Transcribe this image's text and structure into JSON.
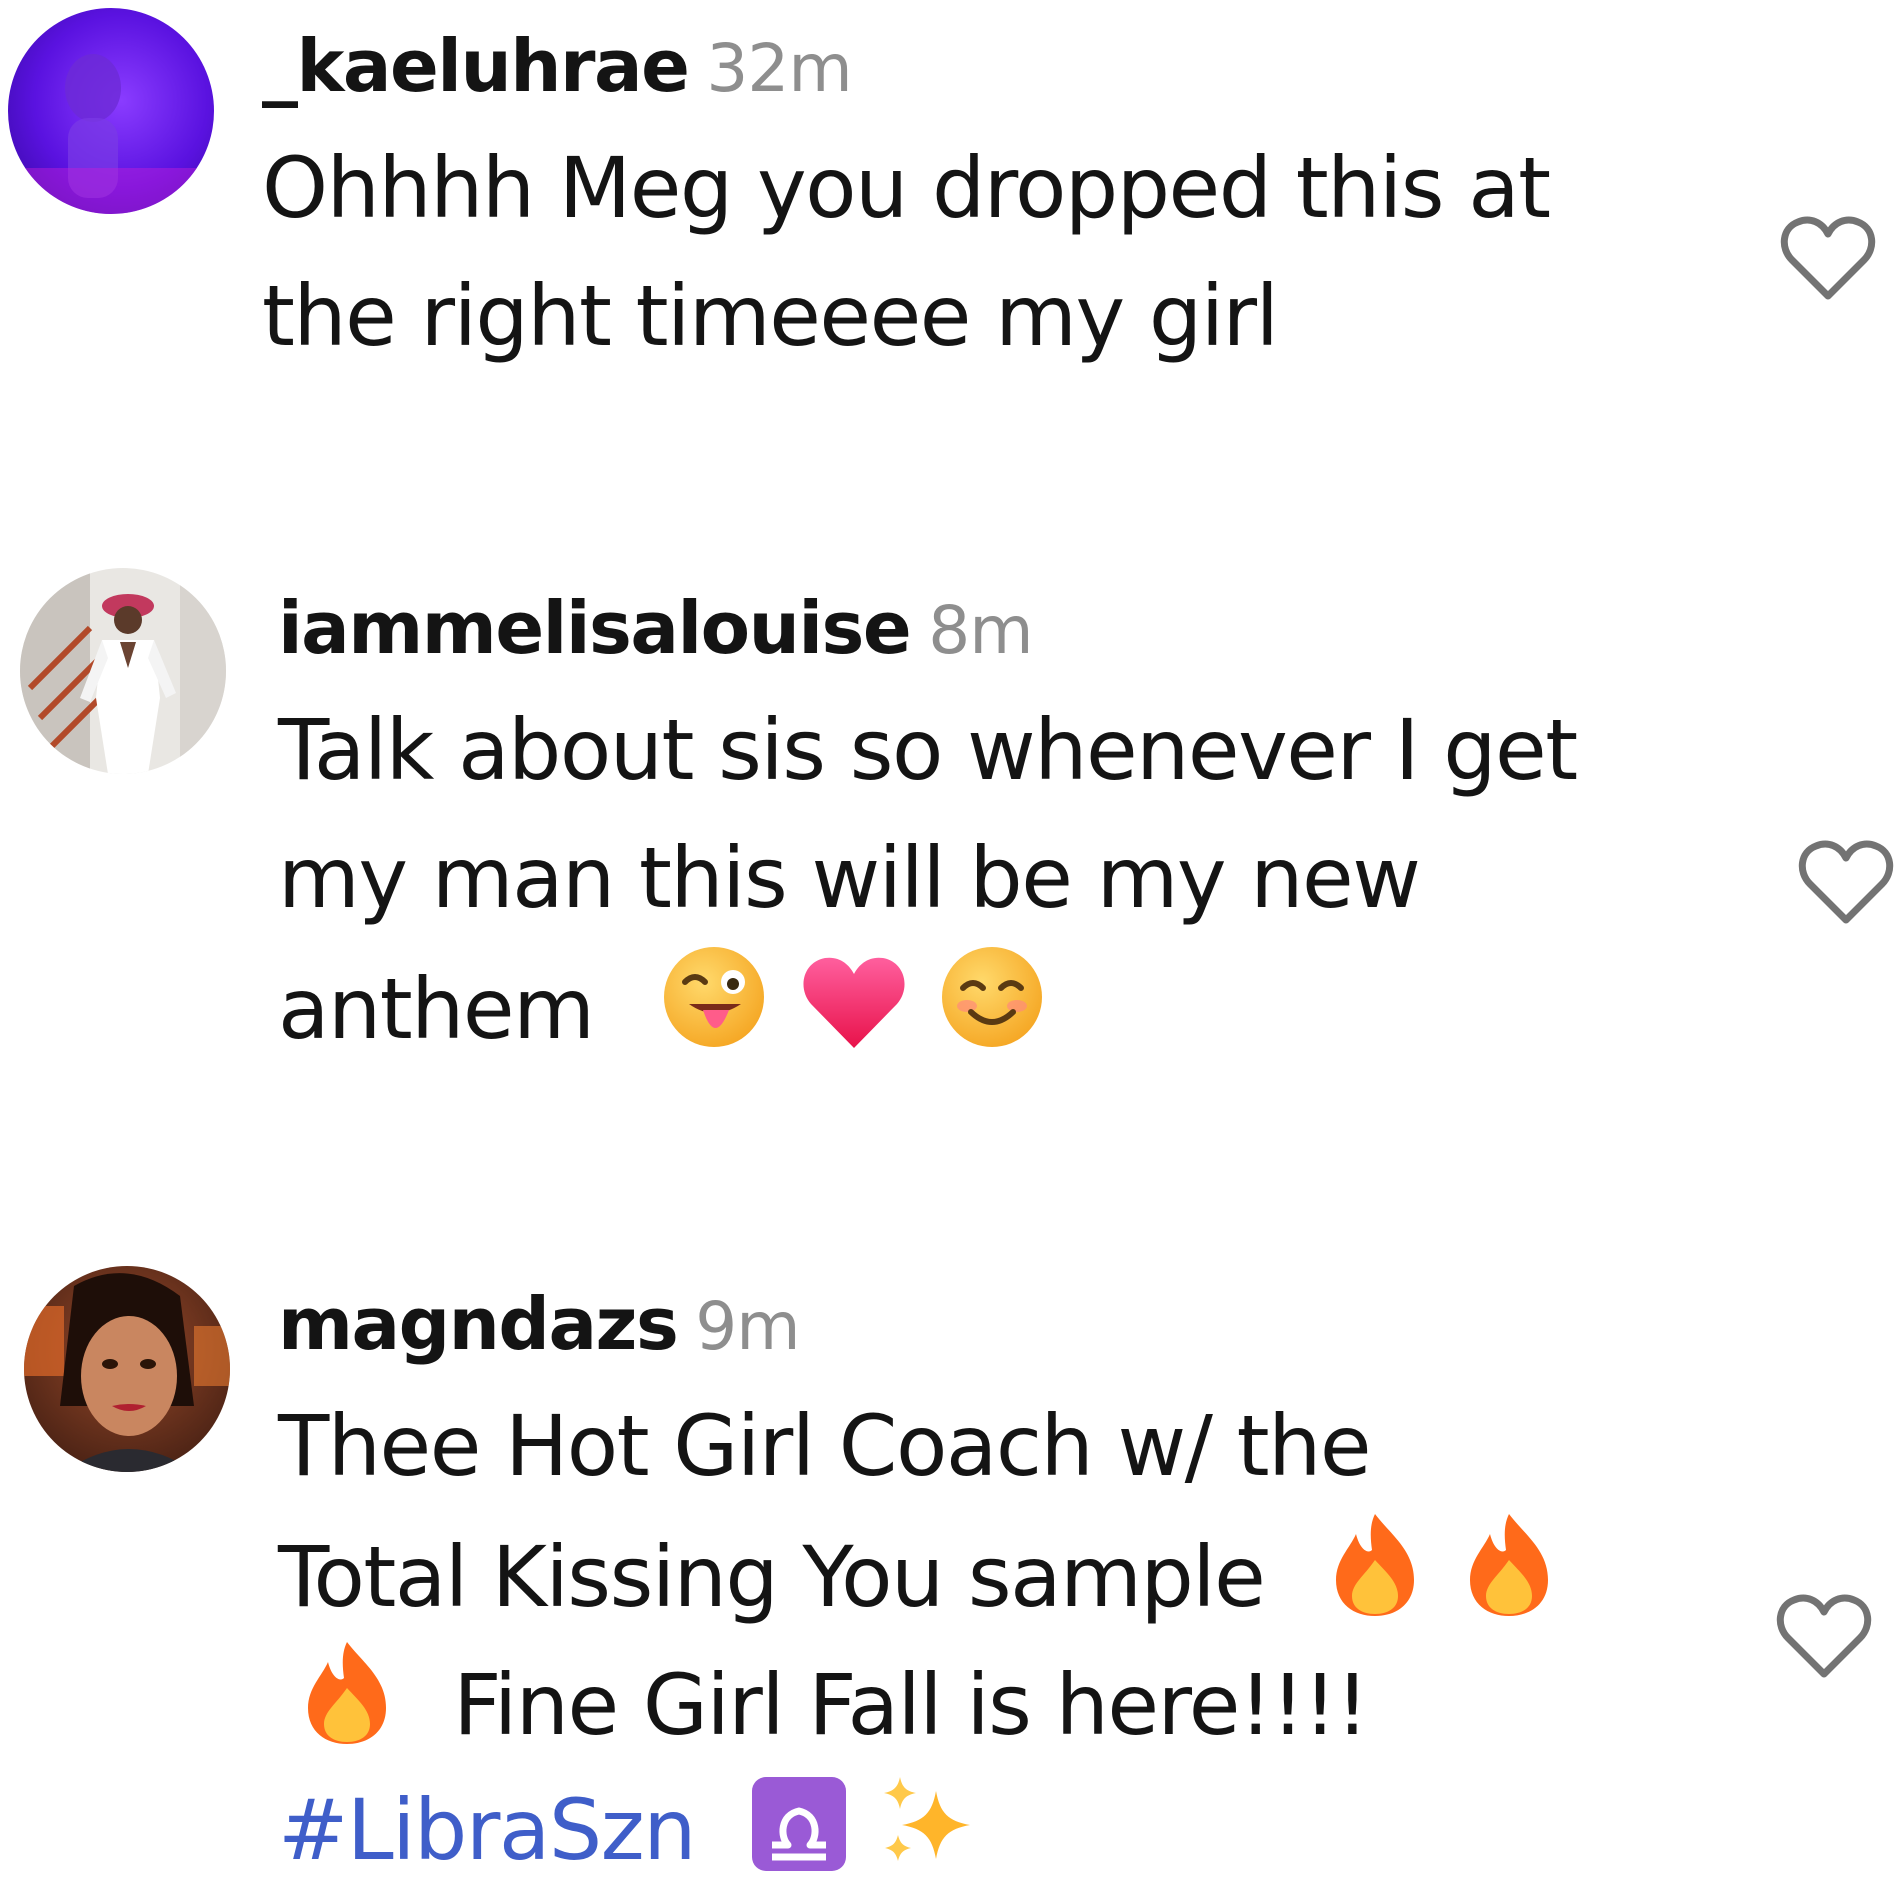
{
  "comments": [
    {
      "username": "_kaeluhrae",
      "time": "32m",
      "lines": [
        "Ohhhh Meg you dropped this at",
        "the right timeeee my girl"
      ]
    },
    {
      "username": "iammelisalouise",
      "time": "8m",
      "lines": [
        "Talk about sis so whenever I get",
        "my man this will be my new",
        "anthem"
      ],
      "emojis": [
        "winking-tongue-face",
        "red-heart",
        "smiling-face"
      ]
    },
    {
      "username": "magndazs",
      "time": "9m",
      "lines": [
        "Thee Hot Girl Coach w/ the",
        "Total Kissing You sample",
        "Fine Girl Fall is here!!!!"
      ],
      "hashtag": "#LibraSzn",
      "emojis": [
        "fire",
        "fire",
        "fire",
        "libra",
        "sparkles"
      ]
    }
  ],
  "colors": {
    "username": "#141414",
    "timestamp": "#8e8e8e",
    "hashtag": "#3f5ec9",
    "heart_outline": "#737373"
  }
}
